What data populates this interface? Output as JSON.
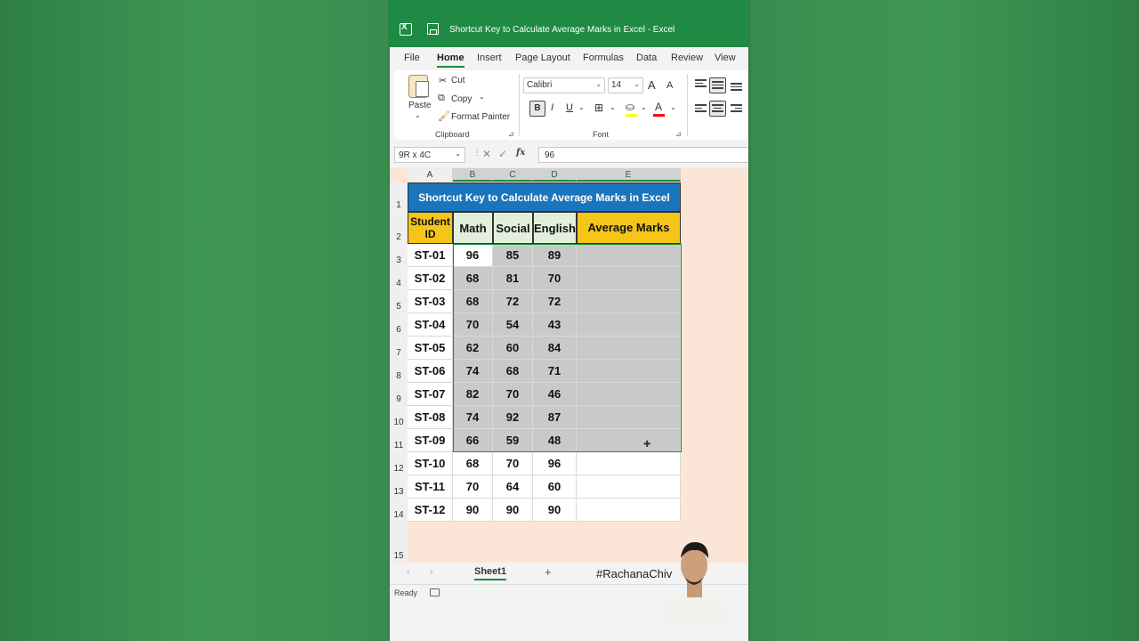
{
  "window": {
    "title": "Shortcut Key to Calculate Average Marks in Excel  -  Excel"
  },
  "menu": [
    "File",
    "Home",
    "Insert",
    "Page Layout",
    "Formulas",
    "Data",
    "Review",
    "View"
  ],
  "ribbon": {
    "clipboard": {
      "paste": "Paste",
      "cut": "Cut",
      "copy": "Copy",
      "format_painter": "Format Painter",
      "label": "Clipboard"
    },
    "font": {
      "name": "Calibri",
      "size": "14",
      "bold": "B",
      "italic": "I",
      "underline": "U",
      "grow": "A",
      "shrink": "A",
      "label": "Font",
      "fill_color": "#ffff00",
      "font_color": "#ff0000"
    }
  },
  "formula_bar": {
    "name_box": "9R x 4C",
    "fx": "fx",
    "value": "96"
  },
  "sheet": {
    "columns": [
      "A",
      "B",
      "C",
      "D",
      "E"
    ],
    "rows": [
      "1",
      "2",
      "3",
      "4",
      "5",
      "6",
      "7",
      "8",
      "9",
      "10",
      "11",
      "12",
      "13",
      "14",
      "15"
    ],
    "banner": "Shortcut Key to Calculate Average Marks in Excel",
    "headers": {
      "student_id": "Student ID",
      "math": "Math",
      "social": "Social",
      "english": "English",
      "average": "Average Marks"
    },
    "records": [
      {
        "id": "ST-01",
        "math": "96",
        "social": "85",
        "english": "89"
      },
      {
        "id": "ST-02",
        "math": "68",
        "social": "81",
        "english": "70"
      },
      {
        "id": "ST-03",
        "math": "68",
        "social": "72",
        "english": "72"
      },
      {
        "id": "ST-04",
        "math": "70",
        "social": "54",
        "english": "43"
      },
      {
        "id": "ST-05",
        "math": "62",
        "social": "60",
        "english": "84"
      },
      {
        "id": "ST-06",
        "math": "74",
        "social": "68",
        "english": "71"
      },
      {
        "id": "ST-07",
        "math": "82",
        "social": "70",
        "english": "46"
      },
      {
        "id": "ST-08",
        "math": "74",
        "social": "92",
        "english": "87"
      },
      {
        "id": "ST-09",
        "math": "66",
        "social": "59",
        "english": "48"
      },
      {
        "id": "ST-10",
        "math": "68",
        "social": "70",
        "english": "96"
      },
      {
        "id": "ST-11",
        "math": "70",
        "social": "64",
        "english": "60"
      },
      {
        "id": "ST-12",
        "math": "90",
        "social": "90",
        "english": "90"
      }
    ],
    "colors": {
      "banner": "#1b75bc",
      "header_yellow": "#f5c518",
      "header_green": "#e2efda",
      "selection": "#1e8a43"
    }
  },
  "tabs": {
    "sheet_name": "Sheet1",
    "add": "+",
    "prev": "‹",
    "next": "›"
  },
  "overlay": {
    "hashtag": "#RachanaChiv"
  },
  "status": {
    "ready": "Ready"
  }
}
